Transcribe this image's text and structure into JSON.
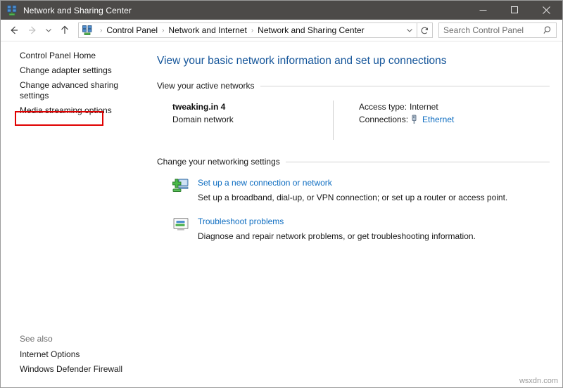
{
  "window": {
    "title": "Network and Sharing Center",
    "title_icon": "network-sharing-icon",
    "minimize_label": "Minimize",
    "maximize_label": "Maximize",
    "close_label": "Close"
  },
  "navigation": {
    "back_label": "Back",
    "forward_label": "Forward",
    "recent_label": "Recent locations",
    "up_label": "Up one level",
    "address_icon": "network-sharing-icon",
    "breadcrumbs": [
      "Control Panel",
      "Network and Internet",
      "Network and Sharing Center"
    ],
    "separator": "›",
    "dropdown_label": "Previous locations",
    "refresh_label": "Refresh"
  },
  "search": {
    "placeholder": "Search Control Panel",
    "value": "",
    "icon": "search-icon"
  },
  "sidebar": {
    "items": [
      {
        "label": "Control Panel Home",
        "highlighted": false
      },
      {
        "label": "Change adapter settings",
        "highlighted": true
      },
      {
        "label": "Change advanced sharing settings",
        "highlighted": false
      },
      {
        "label": "Media streaming options",
        "highlighted": false
      }
    ],
    "see_also": {
      "title": "See also",
      "items": [
        "Internet Options",
        "Windows Defender Firewall"
      ]
    },
    "highlight_color": "#e00000"
  },
  "main": {
    "page_title": "View your basic network information and set up connections",
    "active_networks": {
      "heading": "View your active networks",
      "network": {
        "name": "tweaking.in 4",
        "type": "Domain network",
        "access_type_key": "Access type:",
        "access_type_value": "Internet",
        "connections_key": "Connections:",
        "connections_value": "Ethernet",
        "connections_icon": "ethernet-plug-icon"
      }
    },
    "networking_settings": {
      "heading": "Change your networking settings",
      "items": [
        {
          "icon": "new-connection-icon",
          "title": "Set up a new connection or network",
          "description": "Set up a broadband, dial-up, or VPN connection; or set up a router or access point."
        },
        {
          "icon": "troubleshoot-icon",
          "title": "Troubleshoot problems",
          "description": "Diagnose and repair network problems, or get troubleshooting information."
        }
      ]
    }
  },
  "watermark": "wsxdn.com",
  "colors": {
    "titlebar_bg": "#4c4a48",
    "page_title": "#14559a",
    "link": "#0e6dc1",
    "highlight": "#e00000"
  }
}
